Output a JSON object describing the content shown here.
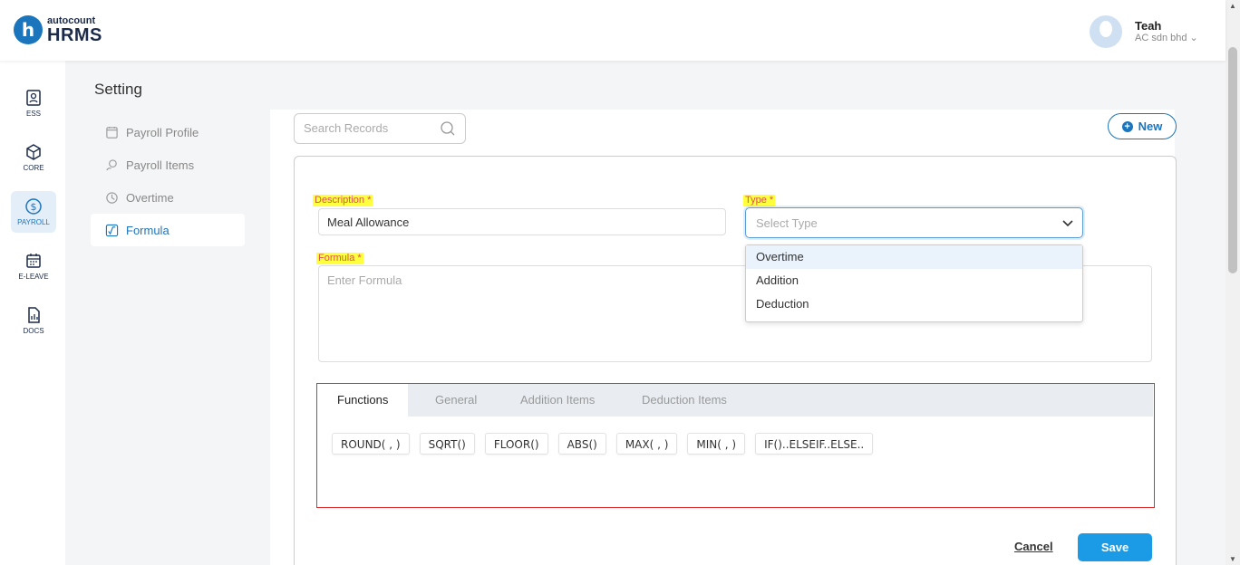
{
  "app": {
    "brand_small": "autocount",
    "brand_big": "HRMS",
    "brand_mark": "h"
  },
  "user": {
    "name": "Teah",
    "company": "AC sdn bhd ⌄"
  },
  "rail": [
    {
      "label": "ESS",
      "icon": "ess-icon"
    },
    {
      "label": "CORE",
      "icon": "core-icon"
    },
    {
      "label": "PAYROLL",
      "icon": "payroll-icon"
    },
    {
      "label": "E-LEAVE",
      "icon": "calendar-icon"
    },
    {
      "label": "DOCS",
      "icon": "docs-icon"
    }
  ],
  "page": {
    "title": "Setting"
  },
  "sub_nav": [
    {
      "label": "Payroll Profile",
      "icon": "profile-icon"
    },
    {
      "label": "Payroll Items",
      "icon": "items-icon"
    },
    {
      "label": "Overtime",
      "icon": "overtime-icon"
    },
    {
      "label": "Formula",
      "icon": "formula-icon"
    }
  ],
  "toolbar": {
    "search_placeholder": "Search Records",
    "new_label": "New"
  },
  "form": {
    "description_label": "Description *",
    "description_value": "Meal Allowance",
    "type_label": "Type *",
    "type_placeholder": "Select Type",
    "type_options": [
      "Overtime",
      "Addition",
      "Deduction"
    ],
    "formula_label": "Formula *",
    "formula_placeholder": "Enter Formula"
  },
  "tabs": [
    "Functions",
    "General",
    "Addition Items",
    "Deduction Items"
  ],
  "functions": [
    "ROUND( , )",
    "SQRT()",
    "FLOOR()",
    "ABS()",
    "MAX( , )",
    "MIN( , )",
    "IF()..ELSEIF..ELSE.."
  ],
  "actions": {
    "cancel_label": "Cancel",
    "save_label": "Save"
  },
  "colors": {
    "accent": "#1b75bc",
    "save": "#1b9be6",
    "highlight": "#ffff3d",
    "required_label": "#d9534f",
    "annotation_border": "#e03030"
  }
}
